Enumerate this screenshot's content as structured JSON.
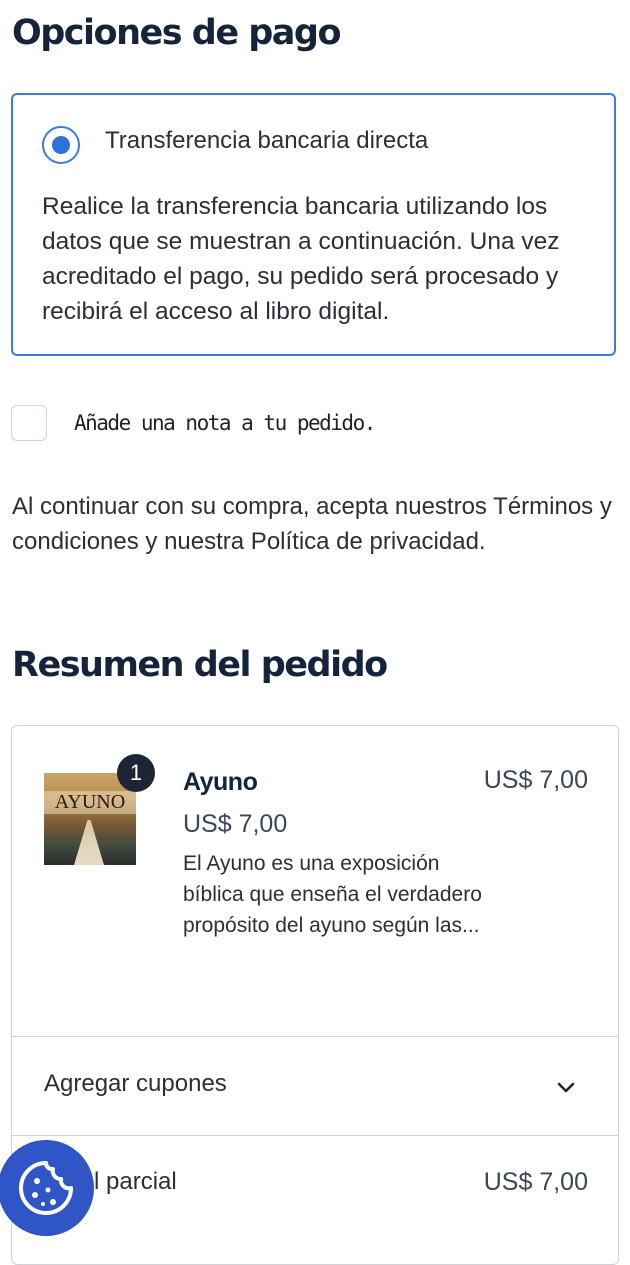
{
  "payment": {
    "title": "Opciones de pago",
    "option_label": "Transferencia bancaria directa",
    "option_description": "Realice la transferencia bancaria utilizando los datos que se muestran a continuación. Una vez acreditado el pago, su pedido será procesado y recibirá el acceso al libro digital."
  },
  "note": {
    "label": "Añade una nota a tu pedido."
  },
  "terms": {
    "text": "Al continuar con su compra, acepta nuestros Términos y condiciones y nuestra Política de privacidad."
  },
  "summary": {
    "title": "Resumen del pedido",
    "item": {
      "quantity": "1",
      "cover_text": "AYUNO",
      "name": "Ayuno",
      "unit_price": "US$ 7,00",
      "description": "El Ayuno es una exposición bíblica que enseña el verdadero propósito del ayuno según las...",
      "line_total": "US$ 7,00"
    },
    "coupons_label": "Agregar cupones",
    "subtotal_label": "l parcial",
    "subtotal_value": "US$ 7,00"
  },
  "colors": {
    "accent": "#3b7ddd",
    "heading": "#15233b",
    "cookie_button": "#2f55c6"
  },
  "icons": {
    "chevron": "chevron-down-icon",
    "cookie": "cookie-icon"
  }
}
